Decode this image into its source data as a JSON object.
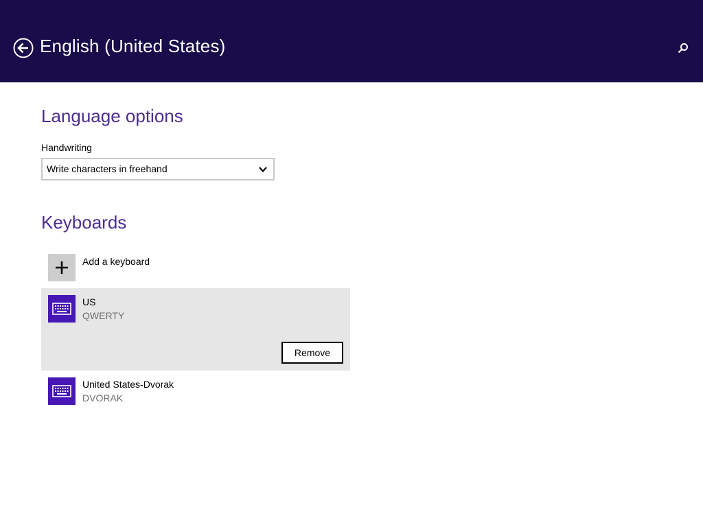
{
  "header": {
    "title": "English (United States)",
    "back_icon": "back-arrow-icon",
    "search_icon": "search-icon",
    "background_color": "#180c4a"
  },
  "language_options": {
    "heading": "Language options",
    "handwriting": {
      "label": "Handwriting",
      "selected_value": "Write characters in freehand",
      "dropdown_icon": "chevron-down-icon"
    }
  },
  "keyboards": {
    "heading": "Keyboards",
    "add_label": "Add a keyboard",
    "add_icon": "plus-icon",
    "items": [
      {
        "name": "US",
        "layout": "QWERTY",
        "icon": "keyboard-icon",
        "selected": true,
        "action_label": "Remove"
      },
      {
        "name": "United States-Dvorak",
        "layout": "DVORAK",
        "icon": "keyboard-icon",
        "selected": false
      }
    ]
  },
  "colors": {
    "accent": "#4c2c92",
    "tile": "#4617b4",
    "selection": "#e6e6e6"
  }
}
